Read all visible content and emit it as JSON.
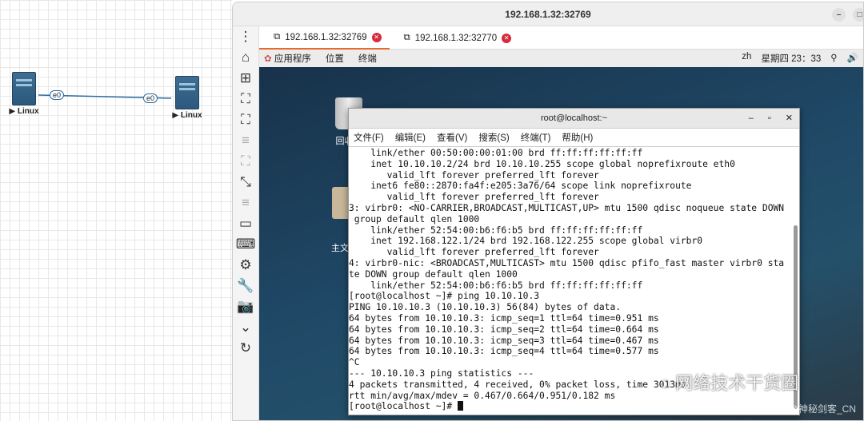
{
  "topology": {
    "nodes": [
      {
        "label": "Linux",
        "iface": "e0"
      },
      {
        "label": "Linux",
        "iface": "e0"
      }
    ]
  },
  "browser": {
    "title": "192.168.1.32:32769",
    "tabs": [
      {
        "label": "192.168.1.32:32769",
        "active": true
      },
      {
        "label": "192.168.1.32:32770",
        "active": false
      }
    ],
    "sidebar_icons": [
      "more-icon",
      "home-icon",
      "add-icon",
      "fit-icon",
      "fullscreen-icon",
      "menu-icon",
      "select-icon",
      "collapse-icon",
      "menu-icon",
      "window-icon",
      "keyboard-icon",
      "settings-icon",
      "wrench-icon",
      "camera-icon",
      "chevron-down-icon",
      "reconnect-icon"
    ]
  },
  "gnome": {
    "apps": "应用程序",
    "places": "位置",
    "terminal": "终端",
    "lang": "zh",
    "clock": "星期四 23：33"
  },
  "desktop": {
    "trash": "回收站",
    "home": "主文件夹"
  },
  "terminal": {
    "title": "root@localhost:~",
    "menu": [
      "文件(F)",
      "编辑(E)",
      "查看(V)",
      "搜索(S)",
      "终端(T)",
      "帮助(H)"
    ],
    "lines": [
      "    link/ether 00:50:00:00:01:00 brd ff:ff:ff:ff:ff:ff",
      "    inet 10.10.10.2/24 brd 10.10.10.255 scope global noprefixroute eth0",
      "       valid_lft forever preferred_lft forever",
      "    inet6 fe80::2870:fa4f:e205:3a76/64 scope link noprefixroute",
      "       valid_lft forever preferred_lft forever",
      "3: virbr0: <NO-CARRIER,BROADCAST,MULTICAST,UP> mtu 1500 qdisc noqueue state DOWN",
      " group default qlen 1000",
      "    link/ether 52:54:00:b6:f6:b5 brd ff:ff:ff:ff:ff:ff",
      "    inet 192.168.122.1/24 brd 192.168.122.255 scope global virbr0",
      "       valid_lft forever preferred_lft forever",
      "4: virbr0-nic: <BROADCAST,MULTICAST> mtu 1500 qdisc pfifo_fast master virbr0 sta",
      "te DOWN group default qlen 1000",
      "    link/ether 52:54:00:b6:f6:b5 brd ff:ff:ff:ff:ff:ff",
      "[root@localhost ~]# ping 10.10.10.3",
      "PING 10.10.10.3 (10.10.10.3) 56(84) bytes of data.",
      "64 bytes from 10.10.10.3: icmp_seq=1 ttl=64 time=0.951 ms",
      "64 bytes from 10.10.10.3: icmp_seq=2 ttl=64 time=0.664 ms",
      "64 bytes from 10.10.10.3: icmp_seq=3 ttl=64 time=0.467 ms",
      "64 bytes from 10.10.10.3: icmp_seq=4 ttl=64 time=0.577 ms",
      "^C",
      "--- 10.10.10.3 ping statistics ---",
      "4 packets transmitted, 4 received, 0% packet loss, time 3013ms",
      "rtt min/avg/max/mdev = 0.467/0.664/0.951/0.182 ms"
    ],
    "prompt": "[root@localhost ~]# "
  },
  "watermark": {
    "wechat": "网络技术干货圈",
    "csdn": "CSDN @神秘剑客_CN"
  }
}
